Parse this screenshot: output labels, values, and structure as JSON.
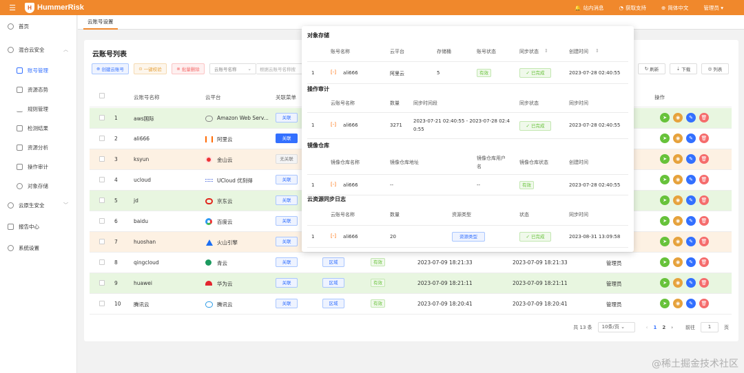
{
  "topbar": {
    "brand": "HummerRisk",
    "messages": "站内消息",
    "support": "获取支持",
    "language": "简体中文",
    "user": "管理员"
  },
  "sidebar": {
    "items": [
      {
        "label": "首页"
      },
      {
        "label": "混合云安全"
      },
      {
        "label": "账号管理"
      },
      {
        "label": "资源态势"
      },
      {
        "label": "规则管理"
      },
      {
        "label": "检测结果"
      },
      {
        "label": "资源分析"
      },
      {
        "label": "操作审计"
      },
      {
        "label": "对象存储"
      },
      {
        "label": "云原生安全"
      },
      {
        "label": "报告中心"
      },
      {
        "label": "系统设置"
      }
    ]
  },
  "tab": {
    "label": "云账号设置"
  },
  "card": {
    "title": "云账号列表",
    "create_btn": "创建云账号",
    "verify_btn": "一键校验",
    "delete_btn": "批量删除",
    "search_field": "云账号名称",
    "search_placeholder": "根据云账号名称搜",
    "refresh_btn": "刷新",
    "download_btn": "下载",
    "columns_btn": "列表"
  },
  "table": {
    "headers": {
      "name": "云账号名称",
      "platform": "云平台",
      "assoc": "关联菜单",
      "ops": "操作"
    },
    "rows": [
      {
        "idx": "1",
        "name": "aws国际",
        "platform": "Amazon Web Serv...",
        "assoc": "关联"
      },
      {
        "idx": "2",
        "name": "ali666",
        "platform": "阿里云",
        "assoc": "关联"
      },
      {
        "idx": "3",
        "name": "ksyun",
        "platform": "金山云",
        "assoc": "无关联"
      },
      {
        "idx": "4",
        "name": "ucloud",
        "platform": "UCloud 优刻得",
        "assoc": "关联"
      },
      {
        "idx": "5",
        "name": "jd",
        "platform": "京东云",
        "assoc": "关联"
      },
      {
        "idx": "6",
        "name": "baidu",
        "platform": "百度云",
        "assoc": "关联"
      },
      {
        "idx": "7",
        "name": "huoshan",
        "platform": "火山引擎",
        "assoc": "关联"
      },
      {
        "idx": "8",
        "name": "qingcloud",
        "platform": "青云",
        "assoc": "关联",
        "region": "区域",
        "status": "有效",
        "created": "2023-07-09 18:21:33",
        "updated": "2023-07-09 18:21:33",
        "creator": "管理员"
      },
      {
        "idx": "9",
        "name": "huawei",
        "platform": "华为云",
        "assoc": "关联",
        "region": "区域",
        "status": "有效",
        "created": "2023-07-09 18:21:11",
        "updated": "2023-07-09 18:21:11",
        "creator": "管理员"
      },
      {
        "idx": "10",
        "name": "腾讯云",
        "platform": "腾讯云",
        "assoc": "关联",
        "region": "区域",
        "status": "有效",
        "created": "2023-07-09 18:20:41",
        "updated": "2023-07-09 18:20:41",
        "creator": "管理员"
      }
    ]
  },
  "pager": {
    "total": "共 13 条",
    "size": "10条/页",
    "page1": "1",
    "page2": "2",
    "goto": "前往",
    "goto_value": "1",
    "suffix": "页"
  },
  "popup": {
    "oss": {
      "title": "对象存储",
      "h_name": "账号名称",
      "h_platform": "云平台",
      "h_buckets": "存储桶",
      "h_status": "账号状态",
      "h_sync": "同步状态",
      "h_created": "创建时间",
      "idx": "1",
      "name": "ali666",
      "platform": "阿里云",
      "buckets": "5",
      "status": "有效",
      "sync": "已完成",
      "created": "2023-07-28 02:40:55"
    },
    "audit": {
      "title": "操作审计",
      "h_name": "云账号名称",
      "h_count": "数量",
      "h_period": "同步时间段",
      "h_sync": "同步状态",
      "h_time": "同步时间",
      "idx": "1",
      "name": "ali666",
      "count": "3271",
      "period1": "2023-07-21 02:40:55 - 2023-07-28 02:4",
      "period2": "0:55",
      "sync": "已完成",
      "time": "2023-07-28 02:40:55"
    },
    "image": {
      "title": "镜像仓库",
      "h_name": "镜像仓库名称",
      "h_addr": "镜像仓库地址",
      "h_user1": "镜像仓库用户",
      "h_user2": "名",
      "h_status": "镜像仓库状态",
      "h_created": "创建时间",
      "idx": "1",
      "name": "ali666",
      "addr": "--",
      "user": "--",
      "status": "有效",
      "created": "2023-07-28 02:40:55"
    },
    "synclog": {
      "title": "云资源同步日志",
      "h_name": "云账号名称",
      "h_count": "数量",
      "h_type": "资源类型",
      "h_status": "状态",
      "h_time": "同步时间",
      "idx": "1",
      "name": "ali666",
      "count": "20",
      "type": "资源类型",
      "status": "已完成",
      "time": "2023-08-31 13:09:58"
    }
  },
  "watermark": "@稀土掘金技术社区",
  "colors": {
    "brand": "#f0882c",
    "primary": "#3370ff",
    "success": "#67c23a",
    "warning": "#e6a23c",
    "danger": "#f56c6c"
  }
}
